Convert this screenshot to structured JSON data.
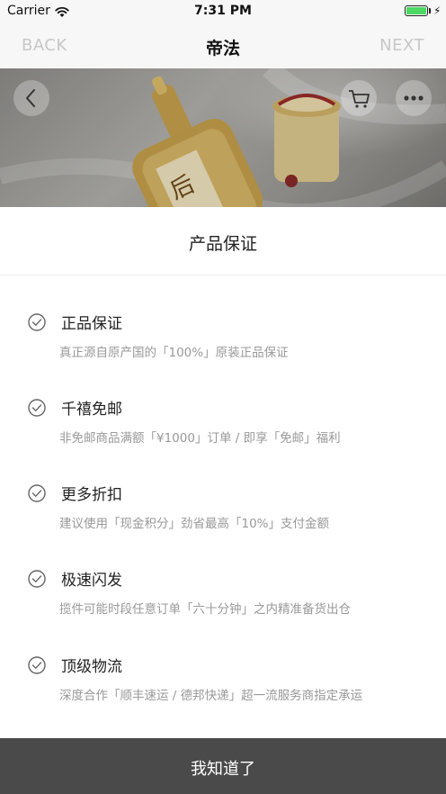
{
  "status_bar": {
    "carrier": "Carrier",
    "time": "7:31 PM",
    "battery_level": 1.0
  },
  "nav": {
    "back_label": "BACK",
    "title": "帝法",
    "next_label": "NEXT"
  },
  "banner": {
    "buttons": [
      "back-icon",
      "cart-icon",
      "more-icon"
    ]
  },
  "section_title": "产品保证",
  "features": [
    {
      "title": "正品保证",
      "desc": "真正源自原产国的「100%」原装正品保证"
    },
    {
      "title": "千禧免邮",
      "desc": "非免邮商品满额「¥1000」订单 / 即享「免邮」福利"
    },
    {
      "title": "更多折扣",
      "desc": "建议使用「现金积分」劲省最高「10%」支付金额"
    },
    {
      "title": "极速闪发",
      "desc": "揽件可能时段任意订单「六十分钟」之内精准备货出仓"
    },
    {
      "title": "顶级物流",
      "desc": "深度合作「顺丰速运 / 德邦快递」超一流服务商指定承运"
    }
  ],
  "confirm_button": "我知道了",
  "colors": {
    "accent_bar": "#4a4a4a",
    "battery": "#4cd964",
    "muted_text": "#999999"
  }
}
